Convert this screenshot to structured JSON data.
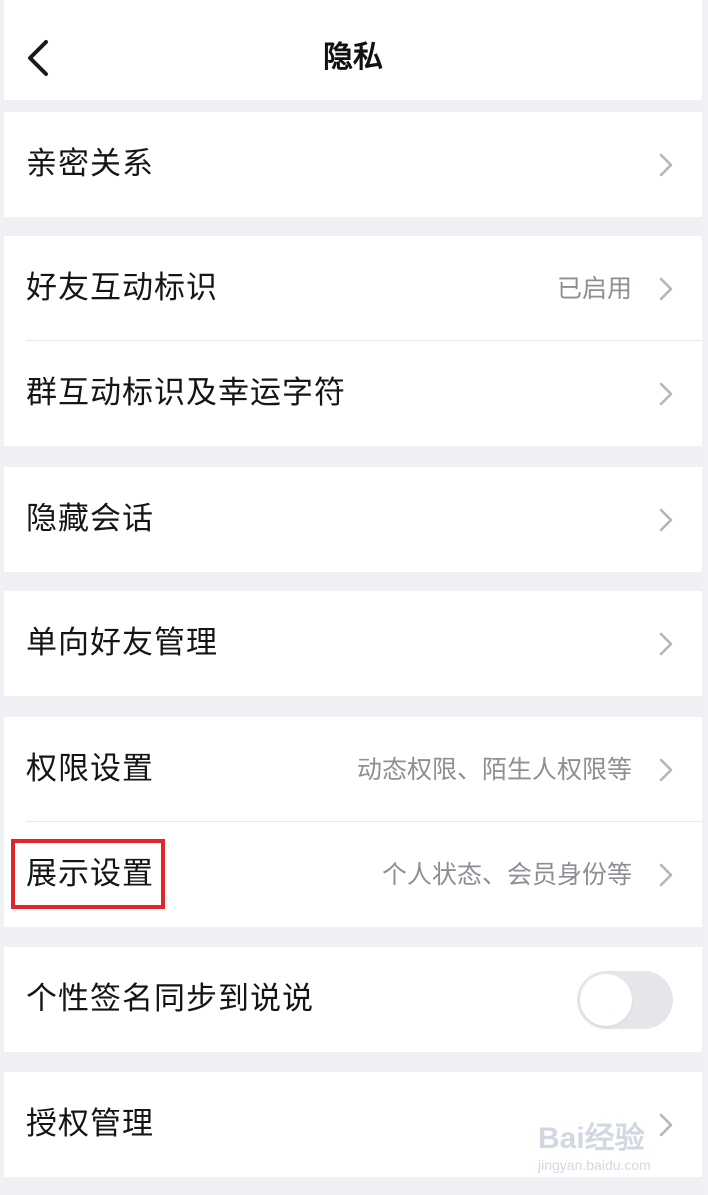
{
  "header": {
    "title": "隐私",
    "back_icon": "chevron-left-icon"
  },
  "groups": [
    {
      "rows": [
        {
          "label": "亲密关系",
          "value": "",
          "control": "chevron"
        }
      ]
    },
    {
      "rows": [
        {
          "label": "好友互动标识",
          "value": "已启用",
          "control": "chevron"
        },
        {
          "label": "群互动标识及幸运字符",
          "value": "",
          "control": "chevron"
        }
      ]
    },
    {
      "rows": [
        {
          "label": "隐藏会话",
          "value": "",
          "control": "chevron"
        }
      ]
    },
    {
      "rows": [
        {
          "label": "单向好友管理",
          "value": "",
          "control": "chevron"
        }
      ]
    },
    {
      "rows": [
        {
          "label": "权限设置",
          "value": "动态权限、陌生人权限等",
          "control": "chevron"
        },
        {
          "label": "展示设置",
          "value": "个人状态、会员身份等",
          "control": "chevron",
          "highlighted": true
        }
      ]
    },
    {
      "rows": [
        {
          "label": "个性签名同步到说说",
          "value": "",
          "control": "toggle",
          "toggle_on": false
        }
      ]
    },
    {
      "rows": [
        {
          "label": "授权管理",
          "value": "",
          "control": "chevron"
        }
      ]
    }
  ],
  "watermark": {
    "brand": "Bai经验",
    "url": "jingyan.baidu.com"
  },
  "colors": {
    "background": "#eff0f4",
    "card": "#ffffff",
    "label": "#151515",
    "value": "#8e8f95",
    "chevron": "#b5b6bb",
    "toggle_off": "#e5e6ea",
    "highlight": "#e0262c"
  }
}
